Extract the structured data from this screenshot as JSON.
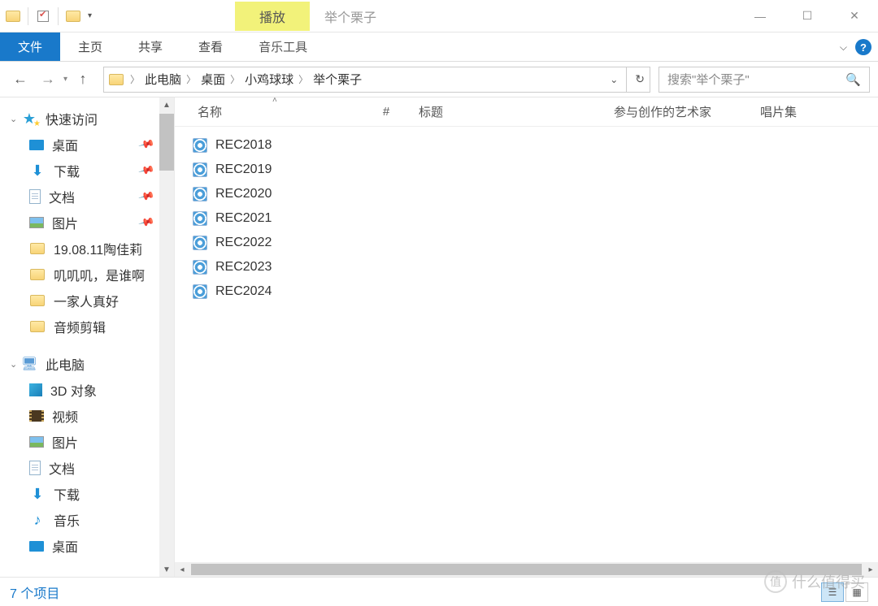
{
  "titlebar": {
    "play_tab": "播放",
    "window_title": "举个栗子"
  },
  "ribbon": {
    "file": "文件",
    "home": "主页",
    "share": "共享",
    "view": "查看",
    "music_tools": "音乐工具"
  },
  "breadcrumbs": [
    "此电脑",
    "桌面",
    "小鸡球球",
    "举个栗子"
  ],
  "search": {
    "placeholder": "搜索\"举个栗子\""
  },
  "sidebar": {
    "quick_access": "快速访问",
    "items_pinned": [
      {
        "label": "桌面",
        "icon": "desktop"
      },
      {
        "label": "下载",
        "icon": "down"
      },
      {
        "label": "文档",
        "icon": "doc"
      },
      {
        "label": "图片",
        "icon": "pic"
      }
    ],
    "items_recent": [
      "19.08.11陶佳莉",
      "叽叽叽，是谁啊",
      "一家人真好",
      "音频剪辑"
    ],
    "this_pc": "此电脑",
    "pc_items": [
      {
        "label": "3D 对象",
        "icon": "3d"
      },
      {
        "label": "视频",
        "icon": "vid"
      },
      {
        "label": "图片",
        "icon": "pic"
      },
      {
        "label": "文档",
        "icon": "doc"
      },
      {
        "label": "下载",
        "icon": "down"
      },
      {
        "label": "音乐",
        "icon": "music"
      },
      {
        "label": "桌面",
        "icon": "desktop"
      }
    ]
  },
  "columns": {
    "name": "名称",
    "number": "#",
    "title": "标题",
    "artist": "参与创作的艺术家",
    "album": "唱片集"
  },
  "files": [
    "REC2018",
    "REC2019",
    "REC2020",
    "REC2021",
    "REC2022",
    "REC2023",
    "REC2024"
  ],
  "status": {
    "item_count": "7 个项目"
  },
  "watermark": "什么值得买"
}
